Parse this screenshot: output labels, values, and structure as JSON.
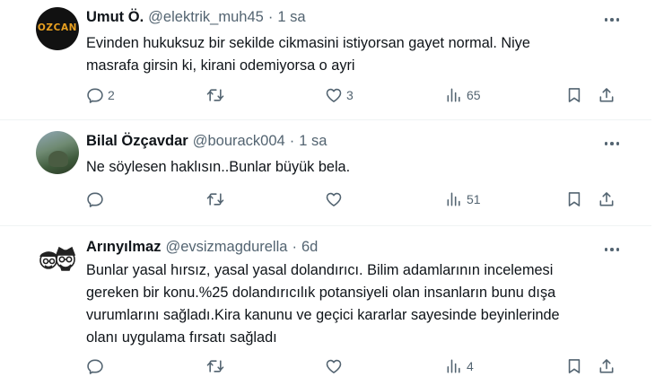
{
  "tweets": [
    {
      "avatar_text": "OZCAN",
      "name": "Umut Ö.",
      "handle": "@elektrik_muh45",
      "separator": "·",
      "time": "1 sa",
      "text": "Evinden hukuksuz bir sekilde cikmasini istiyorsan gayet normal. Niye\nmasrafa girsin ki, kirani odemiyorsa o ayri",
      "reply_count": "2",
      "retweet_count": "",
      "like_count": "3",
      "view_count": "65"
    },
    {
      "name": "Bilal Özçavdar",
      "handle": "@bourack004",
      "separator": "·",
      "time": "1 sa",
      "text": "Ne söylesen haklısın..Bunlar büyük bela.",
      "reply_count": "",
      "retweet_count": "",
      "like_count": "",
      "view_count": "51"
    },
    {
      "name": "Arınyılmaz",
      "handle": "@evsizmagdurella",
      "separator": "·",
      "time": "6d",
      "text": "Bunlar yasal hırsız, yasal  yasal dolandırıcı. Bilim adamlarının incelemesi\ngereken bir konu.%25  dolandırıcılık potansiyeli olan insanların bunu dışa\nvurumlarını  sağladı.Kira kanunu ve geçici kararlar sayesinde beyinlerinde\nolanı uygulama fırsatı sağladı",
      "reply_count": "",
      "retweet_count": "",
      "like_count": "",
      "view_count": "4"
    }
  ],
  "colors": {
    "text_primary": "#0f1419",
    "text_secondary": "#536471",
    "divider": "#eff3f4"
  }
}
